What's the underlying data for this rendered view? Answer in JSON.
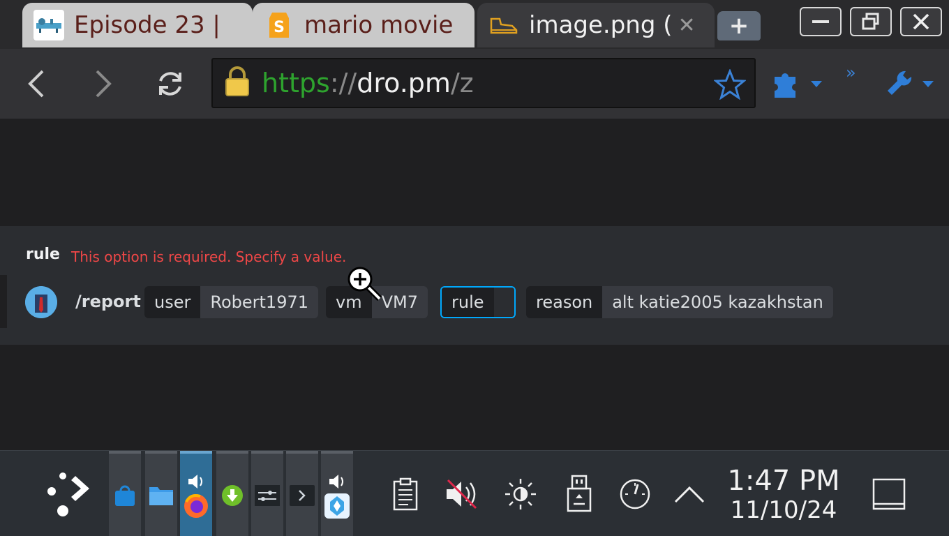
{
  "tabs": [
    {
      "title": "Episode 23 |",
      "favicon": "dinosaur-favicon-icon"
    },
    {
      "title": "mario movie",
      "favicon": "s-logo-favicon-icon"
    },
    {
      "title": "image.png (",
      "favicon": "shoe-favicon-icon",
      "close_glyph": "✕"
    }
  ],
  "new_tab_label": "+",
  "toolbar": {
    "url_scheme": "https",
    "url_sep": "://",
    "url_host": "dro.pm",
    "url_path": "/z",
    "overflow_glyph": "»"
  },
  "command": {
    "error_field": "rule",
    "error_message": "This option is required. Specify a value.",
    "name": "/report",
    "options": [
      {
        "key": "user",
        "value": "Robert1971"
      },
      {
        "key": "vm",
        "value": "VM7"
      },
      {
        "key": "rule",
        "value": ""
      },
      {
        "key": "reason",
        "value": "alt katie2005 kazakhstan"
      }
    ]
  },
  "clock": {
    "time": "1:47 PM",
    "date": "11/10/24"
  },
  "colors": {
    "accent": "#00a8fc",
    "error": "#f04747",
    "secure": "#2ea32e"
  }
}
